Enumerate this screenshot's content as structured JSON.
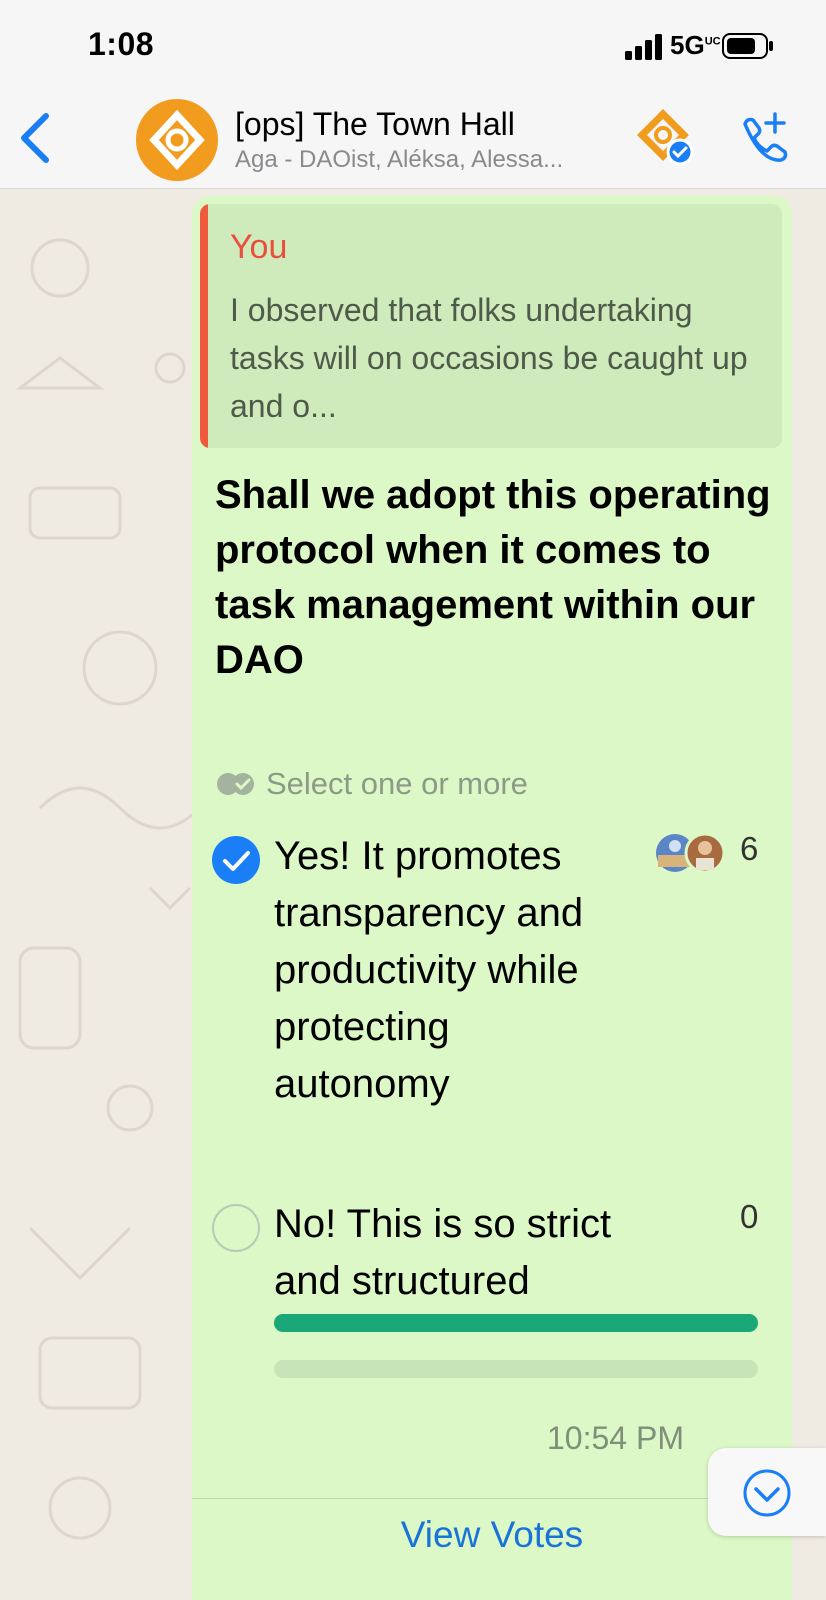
{
  "status_bar": {
    "time": "1:08",
    "network": "5G",
    "network_sup": "UC"
  },
  "header": {
    "title": "[ops] The Town Hall",
    "subtitle": "Aga - DAOist, Aléksa, Alessa..."
  },
  "quoted": {
    "author": "You",
    "text": "I observed that folks undertaking tasks will on occasions be caught up and o..."
  },
  "poll": {
    "question": "Shall we adopt this operating protocol when it comes to task management within our DAO",
    "hint": "Select one or more",
    "options": [
      {
        "label": "Yes! It promotes transparency and productivity while protecting autonomy",
        "votes": "6",
        "checked": true,
        "fraction": 1.0
      },
      {
        "label": "No! This is so strict and structured",
        "votes": "0",
        "checked": false,
        "fraction": 0.0
      }
    ],
    "timestamp": "10:54 PM",
    "view_votes": "View Votes"
  },
  "colors": {
    "accent_blue": "#1a7ef7",
    "bar_fill": "#1aa878",
    "bubble": "#dcf8c6",
    "quote_author": "#ea4e3d"
  },
  "icons": [
    "back-chevron-icon",
    "group-avatar",
    "community-icon",
    "add-call-icon",
    "check-icon",
    "double-check-icon",
    "chevron-down-icon"
  ]
}
